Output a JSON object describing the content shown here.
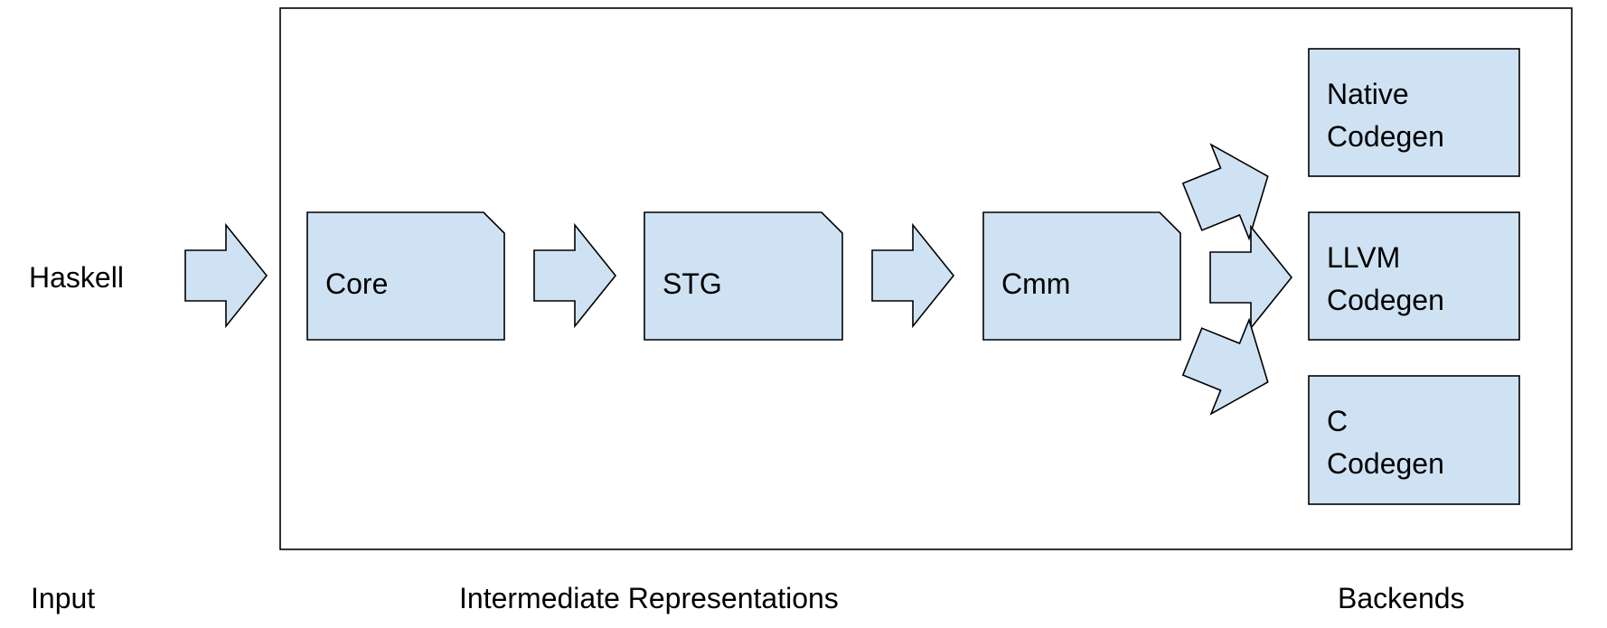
{
  "input_label": "Haskell",
  "intermediate": [
    "Core",
    "STG",
    "Cmm"
  ],
  "backends": [
    {
      "line1": "Native",
      "line2": "Codegen"
    },
    {
      "line1": "LLVM",
      "line2": "Codegen"
    },
    {
      "line1": "C",
      "line2": "Codegen"
    }
  ],
  "captions": {
    "input": "Input",
    "intermediate": "Intermediate Representations",
    "backends": "Backends"
  },
  "colors": {
    "box_fill": "#cfe2f3",
    "stroke": "#000000"
  }
}
